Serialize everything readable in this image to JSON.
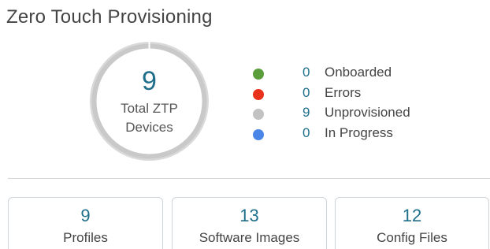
{
  "header": {
    "title": "Zero Touch Provisioning"
  },
  "summary": {
    "total_count": "9",
    "total_label_line1": "Total ZTP",
    "total_label_line2": "Devices",
    "ring_color": "#c9c9c9"
  },
  "legend": [
    {
      "icon": "green-status-dot",
      "color": "#5a9e3c",
      "count": "0",
      "label": "Onboarded"
    },
    {
      "icon": "red-status-dot",
      "color": "#e8321b",
      "count": "0",
      "label": "Errors"
    },
    {
      "icon": "gray-status-dot",
      "color": "#c2c2c2",
      "count": "9",
      "label": "Unprovisioned"
    },
    {
      "icon": "blue-status-dot",
      "color": "#4a86e8",
      "count": "0",
      "label": "In Progress"
    }
  ],
  "cards": [
    {
      "count": "9",
      "label": "Profiles"
    },
    {
      "count": "13",
      "label": "Software Images"
    },
    {
      "count": "12",
      "label": "Config Files"
    }
  ],
  "colors": {
    "accent_number": "#1f6f8b",
    "divider": "#d6d6d6",
    "card_border": "#cfd4d8"
  }
}
